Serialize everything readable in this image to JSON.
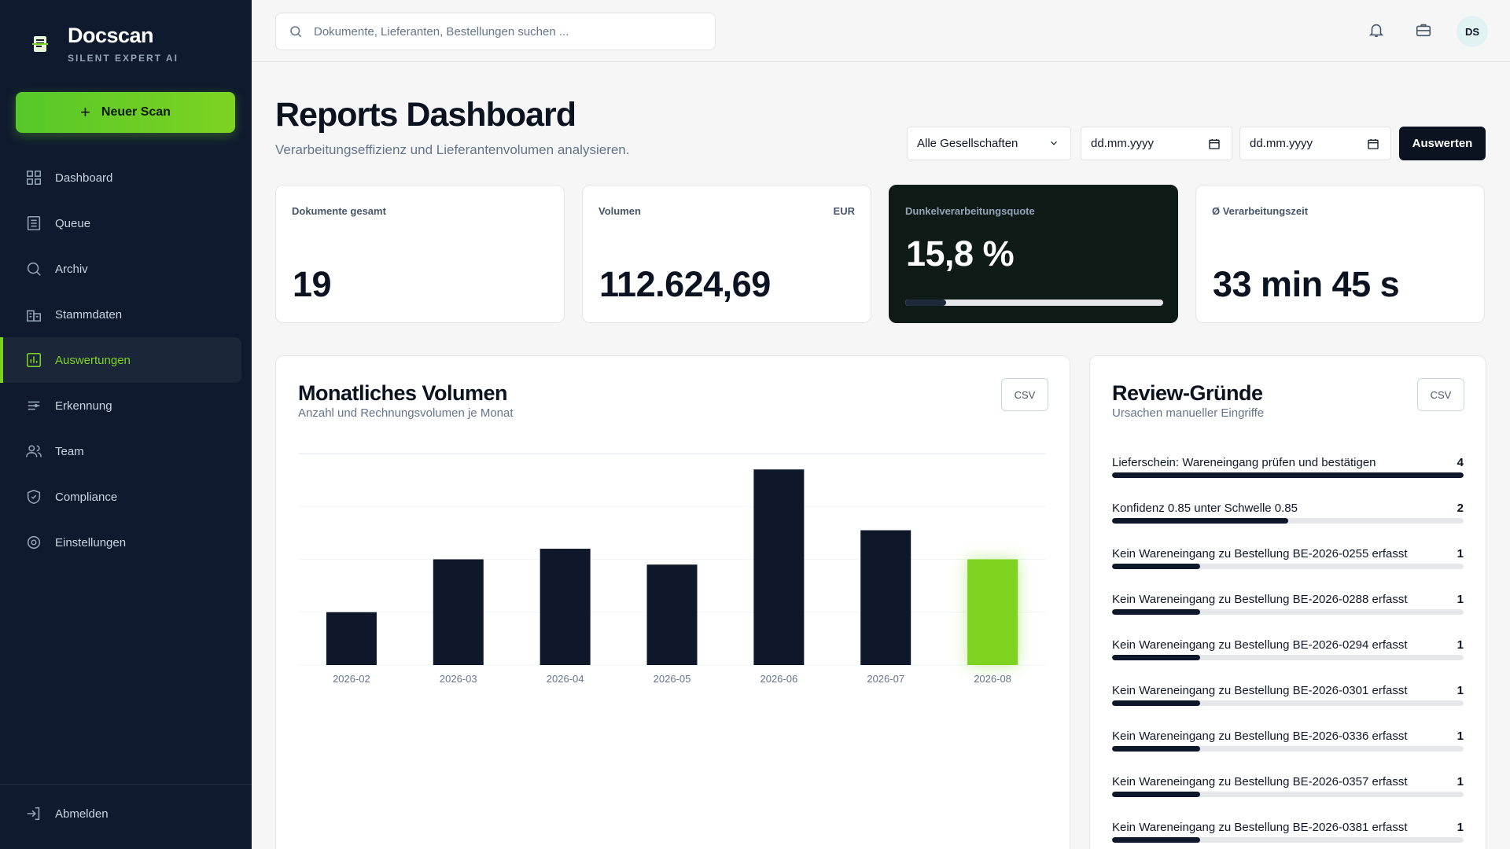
{
  "brand": {
    "name": "Docscan",
    "tagline": "SILENT EXPERT AI"
  },
  "sidebar": {
    "new_scan_label": "Neuer Scan",
    "items": [
      {
        "label": "Dashboard",
        "icon": "grid-icon"
      },
      {
        "label": "Queue",
        "icon": "list-icon"
      },
      {
        "label": "Archiv",
        "icon": "search-icon"
      },
      {
        "label": "Stammdaten",
        "icon": "building-icon"
      },
      {
        "label": "Auswertungen",
        "icon": "chart-icon",
        "active": true
      },
      {
        "label": "Erkennung",
        "icon": "sliders-icon"
      },
      {
        "label": "Team",
        "icon": "users-icon"
      },
      {
        "label": "Compliance",
        "icon": "shield-icon"
      },
      {
        "label": "Einstellungen",
        "icon": "gear-icon"
      }
    ],
    "logout_label": "Abmelden"
  },
  "topbar": {
    "search_placeholder": "Dokumente, Lieferanten, Bestellungen suchen ...",
    "avatar_initials": "DS"
  },
  "header": {
    "title": "Reports Dashboard",
    "subtitle": "Verarbeitungseffizienz und Lieferantenvolumen analysieren."
  },
  "filters": {
    "company_select": "Alle Gesellschaften",
    "date_from_placeholder": "dd.mm.yyyy",
    "date_to_placeholder": "dd.mm.yyyy",
    "submit_label": "Auswerten"
  },
  "kpis": [
    {
      "label": "Dokumente gesamt",
      "value": "19"
    },
    {
      "label": "Volumen",
      "unit": "EUR",
      "value": "112.624,69"
    },
    {
      "label": "Dunkelverarbeitungsquote",
      "value": "15,8 %",
      "progress": 0.158
    },
    {
      "label": "Ø Verarbeitungszeit",
      "value": "33 min 45 s"
    }
  ],
  "volume_panel": {
    "title": "Monatliches Volumen",
    "subtitle": "Anzahl und Rechnungsvolumen je Monat",
    "csv_label": "CSV"
  },
  "chart_data": {
    "type": "bar",
    "categories": [
      "2026-02",
      "2026-03",
      "2026-04",
      "2026-05",
      "2026-06",
      "2026-07",
      "2026-08"
    ],
    "values": [
      1,
      2,
      2.2,
      1.9,
      3.7,
      2.55,
      2
    ],
    "ylim": [
      0,
      4
    ],
    "grid": true,
    "colors": {
      "default": "#0f172a",
      "highlight": "#7ed321"
    },
    "highlight_index": 6
  },
  "review_panel": {
    "title": "Review-Gründe",
    "subtitle": "Ursachen manueller Eingriffe",
    "csv_label": "CSV",
    "max": 4,
    "items": [
      {
        "label": "Lieferschein: Wareneingang prüfen und bestätigen",
        "count": 4
      },
      {
        "label": "Konfidenz 0.85 unter Schwelle 0.85",
        "count": 2
      },
      {
        "label": "Kein Wareneingang zu Bestellung BE-2026-0255 erfasst",
        "count": 1
      },
      {
        "label": "Kein Wareneingang zu Bestellung BE-2026-0288 erfasst",
        "count": 1
      },
      {
        "label": "Kein Wareneingang zu Bestellung BE-2026-0294 erfasst",
        "count": 1
      },
      {
        "label": "Kein Wareneingang zu Bestellung BE-2026-0301 erfasst",
        "count": 1
      },
      {
        "label": "Kein Wareneingang zu Bestellung BE-2026-0336 erfasst",
        "count": 1
      },
      {
        "label": "Kein Wareneingang zu Bestellung BE-2026-0357 erfasst",
        "count": 1
      },
      {
        "label": "Kein Wareneingang zu Bestellung BE-2026-0381 erfasst",
        "count": 1
      }
    ]
  }
}
